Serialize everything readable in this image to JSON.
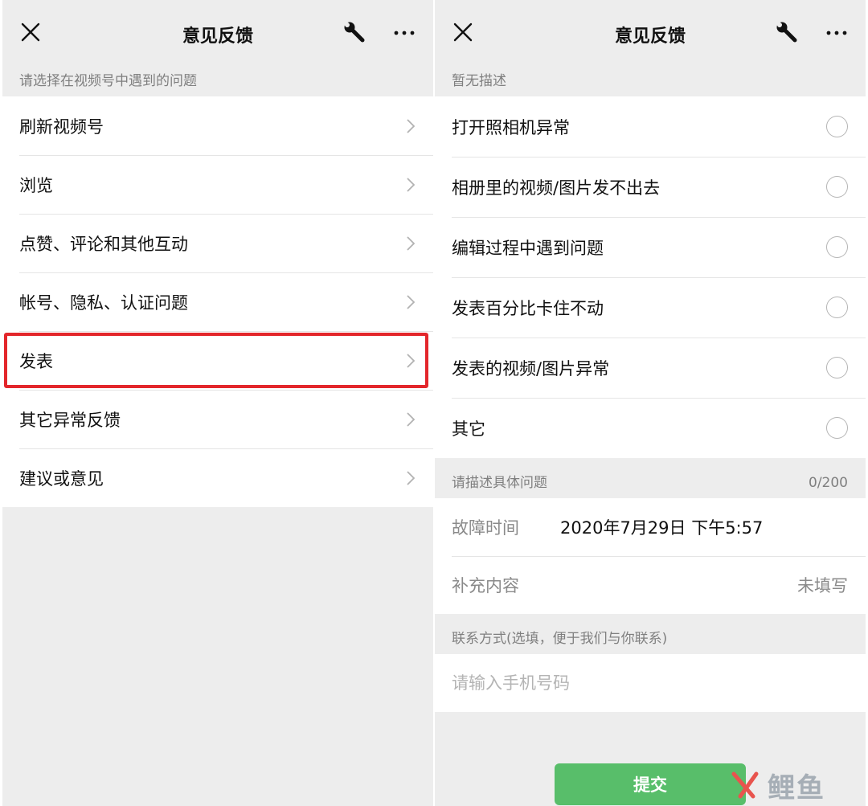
{
  "left": {
    "title": "意见反馈",
    "section_label": "请选择在视频号中遇到的问题",
    "items": [
      {
        "label": "刷新视频号"
      },
      {
        "label": "浏览"
      },
      {
        "label": "点赞、评论和其他互动"
      },
      {
        "label": "帐号、隐私、认证问题"
      },
      {
        "label": "发表",
        "highlighted": true
      },
      {
        "label": "其它异常反馈"
      },
      {
        "label": "建议或意见"
      }
    ]
  },
  "right": {
    "title": "意见反馈",
    "section_label": "暂无描述",
    "options": [
      {
        "label": "打开照相机异常"
      },
      {
        "label": "相册里的视频/图片发不出去"
      },
      {
        "label": "编辑过程中遇到问题"
      },
      {
        "label": "发表百分比卡住不动"
      },
      {
        "label": "发表的视频/图片异常"
      },
      {
        "label": "其它"
      }
    ],
    "describe_label": "请描述具体问题",
    "describe_count": "0/200",
    "fault_time_label": "故障时间",
    "fault_time_value": "2020年7月29日 下午5:57",
    "supplement_label": "补充内容",
    "supplement_value": "未填写",
    "contact_label": "联系方式(选填，便于我们与你联系)",
    "phone_placeholder": "请输入手机号码",
    "submit_label": "提交"
  },
  "watermark": {
    "text": "鲤鱼"
  },
  "colors": {
    "highlight": "#e3262b",
    "submit": "#58be6a",
    "background": "#ededed"
  },
  "icons": {
    "close": "close-icon",
    "tools": "wrench-icon",
    "more": "more-icon",
    "chevron": "chevron-right-icon",
    "radio": "radio-icon"
  }
}
